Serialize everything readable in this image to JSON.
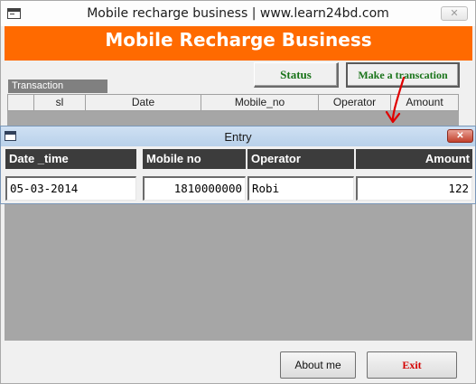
{
  "main_window": {
    "title": "Mobile recharge business | www.learn24bd.com",
    "close_glyph": "✕",
    "header_title": "Mobile Recharge Business",
    "buttons": {
      "status": "Status",
      "make_transaction": "Make a transcation",
      "about": "About me",
      "exit": "Exit"
    },
    "group_label": "Transaction",
    "grid_columns": [
      "sl",
      "Date",
      "Mobile_no",
      "Operator",
      "Amount"
    ]
  },
  "entry_window": {
    "title": "Entry",
    "close_glyph": "✕",
    "labels": {
      "date_time": "Date _time",
      "mobile_no": "Mobile no",
      "operator": "Operator",
      "amount": "Amount"
    },
    "values": {
      "date_time": "05-03-2014",
      "mobile_no": "1810000000",
      "operator": "Robi",
      "amount": "122"
    }
  },
  "colors": {
    "header_band": "#ff6a00",
    "button_text_green": "#197319",
    "exit_text": "#d40000",
    "annotation_arrow": "#e00000",
    "empty_area": "#a6a6a6"
  },
  "icons": [
    "window-icon",
    "close-icon",
    "red-arrow-annotation"
  ]
}
